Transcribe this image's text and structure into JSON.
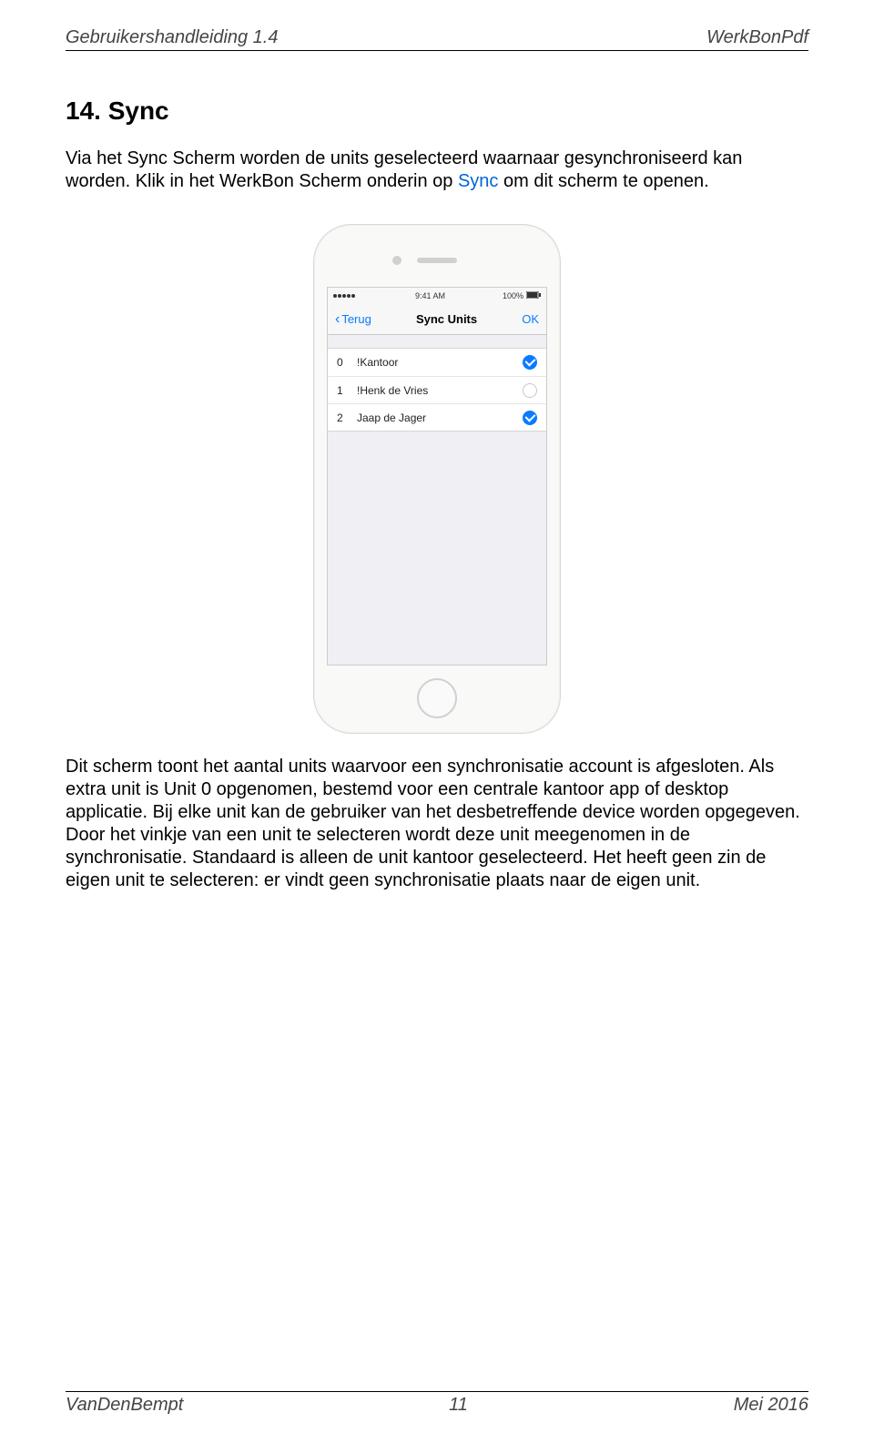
{
  "header": {
    "left": "Gebruikershandleiding 1.4",
    "right": "WerkBonPdf"
  },
  "section": {
    "title": "14. Sync"
  },
  "para1": {
    "pre": "Via het Sync Scherm worden de units geselecteerd waarnaar gesynchroniseerd kan worden. Klik in het WerkBon Scherm onderin op ",
    "link": "Sync",
    "post": " om dit scherm te openen."
  },
  "phone": {
    "status": {
      "carrier": "",
      "time": "9:41 AM",
      "battery": "100%"
    },
    "nav": {
      "back": "Terug",
      "title": "Sync Units",
      "ok": "OK"
    },
    "rows": [
      {
        "idx": "0",
        "name": "!Kantoor",
        "checked": true
      },
      {
        "idx": "1",
        "name": "!Henk de Vries",
        "checked": false
      },
      {
        "idx": "2",
        "name": "Jaap de Jager",
        "checked": true
      }
    ]
  },
  "para2": "Dit scherm toont het aantal units waarvoor een synchronisatie account is afgesloten. Als extra unit is Unit 0 opgenomen, bestemd voor een centrale kantoor app of desktop applicatie. Bij elke unit kan de gebruiker van het desbetreffende device worden opgegeven. Door het vinkje van een unit te selecteren wordt deze unit meegenomen in de synchronisatie. Standaard is alleen de unit kantoor geselecteerd. Het heeft geen zin de eigen unit te selecteren: er vindt geen synchronisatie plaats naar de eigen unit.",
  "footer": {
    "left": "VanDenBempt",
    "center": "11",
    "right": "Mei 2016"
  }
}
